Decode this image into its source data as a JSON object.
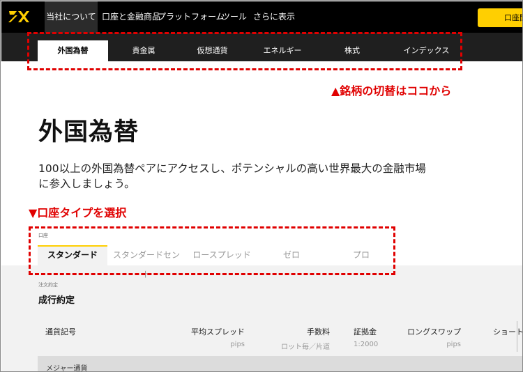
{
  "topnav": {
    "logo_icon": "fx-logo-icon",
    "items": [
      "当社について",
      "口座と金融商品",
      "プラットフォーム",
      "ツール",
      "さらに表示"
    ],
    "open_account_label": "口座開設"
  },
  "subtabs": {
    "items": [
      "外国為替",
      "貴金属",
      "仮想通貨",
      "エネルギー",
      "株式",
      "インデックス"
    ],
    "active_index": 0
  },
  "annotations": {
    "symbol_switch": "▲銘柄の切替はココから",
    "account_select": "▼口座タイプを選択"
  },
  "hero": {
    "title": "外国為替",
    "description": "100以上の外国為替ペアにアクセスし、ポテンシャルの高い世界最大の金融市場に参入しましょう。"
  },
  "account": {
    "caption": "口座",
    "tabs": [
      "スタンダード",
      "スタンダードセント",
      "ロースプレッド",
      "ゼロ",
      "プロ"
    ],
    "active_index": 0
  },
  "execution": {
    "caption": "注文約定",
    "title": "成行約定"
  },
  "table": {
    "columns": [
      {
        "label": "通貨記号",
        "sub": ""
      },
      {
        "label": "平均スプレッド",
        "sub": "pips"
      },
      {
        "label": "手数料",
        "sub": "ロット毎／片道"
      },
      {
        "label": "証拠金",
        "sub": "1:2000"
      },
      {
        "label": "ロングスワップ",
        "sub": "pips"
      },
      {
        "label": "ショート",
        "sub": ""
      }
    ],
    "group_label": "メジャー通貨"
  },
  "colors": {
    "accent": "#ffcf01",
    "annotation": "#e00000",
    "nav_bg": "#000000"
  }
}
